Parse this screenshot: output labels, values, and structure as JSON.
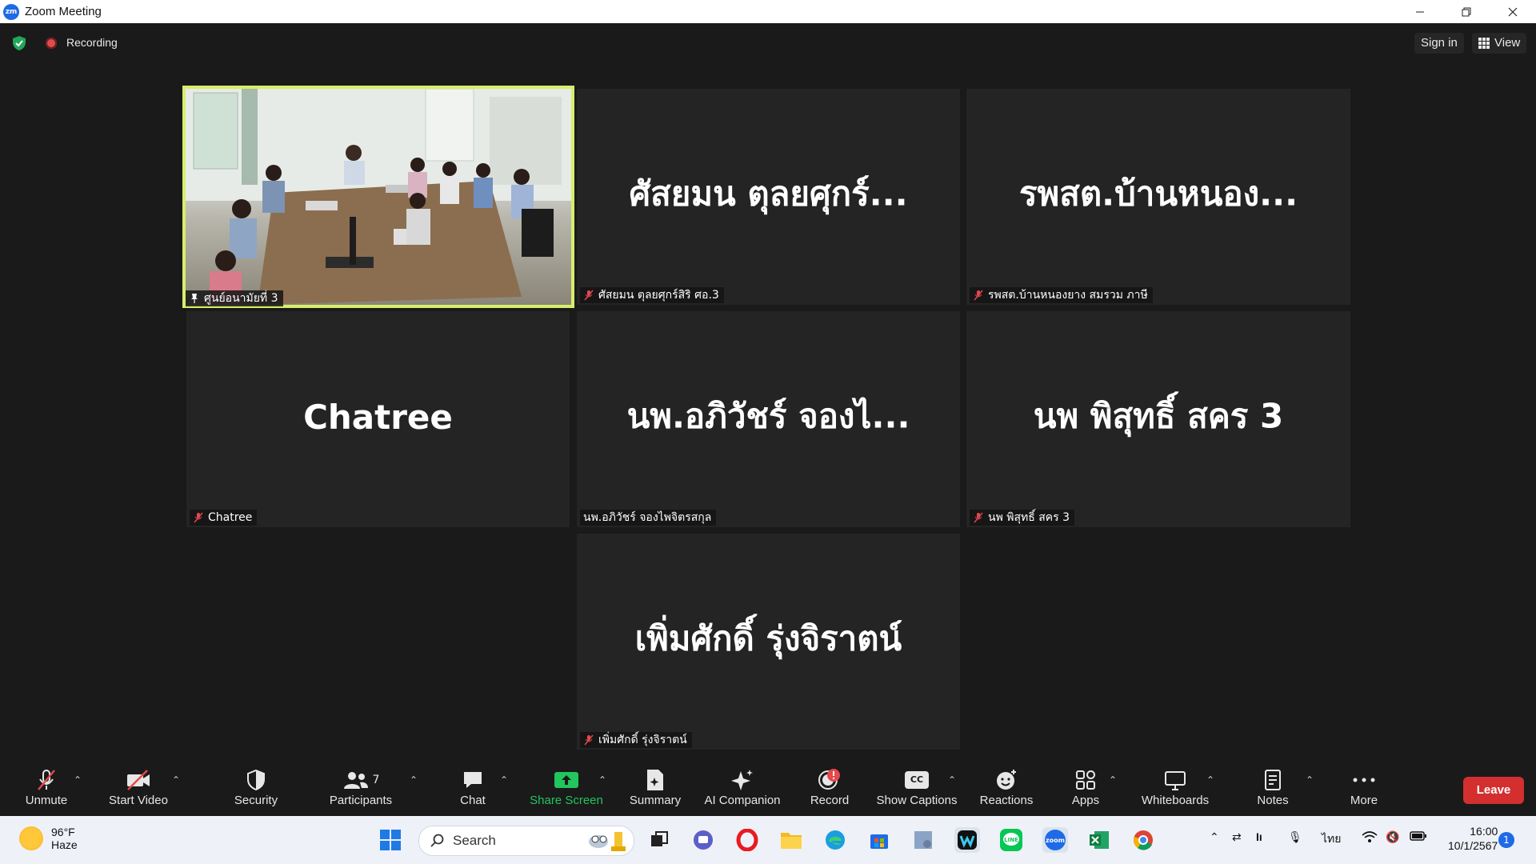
{
  "window": {
    "title": "Zoom Meeting",
    "app_icon_text": "zm"
  },
  "topbar": {
    "recording_label": "Recording",
    "sign_in_label": "Sign in",
    "view_label": "View"
  },
  "tiles": [
    {
      "big_name": "",
      "label": "ศูนย์อนามัยที่ 3",
      "pinned": true,
      "active": true,
      "has_video": true
    },
    {
      "big_name": "ศัสยมน ตุลยศุกร์...",
      "label": "ศัสยมน ตุลยศุกร์สิริ ศอ.3",
      "muted": true
    },
    {
      "big_name": "รพสต.บ้านหนอง...",
      "label": "รพสต.บ้านหนองยาง สมรวม ภาษี",
      "muted": true
    },
    {
      "big_name": "Chatree",
      "label": "Chatree",
      "muted": true
    },
    {
      "big_name": "นพ.อภิวัชร์ จองไ...",
      "label": "นพ.อภิวัชร์ จองไพจิตรสกุล",
      "muted": false
    },
    {
      "big_name": "นพ พิสุทธิ์ สคร 3",
      "label": "นพ พิสุทธิ์ สคร 3",
      "muted": true
    },
    {
      "big_name": "เพิ่มศักดิ์ รุ่งจิราตน์",
      "label": "เพิ่มศักดิ์ รุ่งจิราตน์",
      "muted": true
    }
  ],
  "toolbar": {
    "unmute": "Unmute",
    "start_video": "Start Video",
    "security": "Security",
    "participants": "Participants",
    "participants_count": "7",
    "chat": "Chat",
    "share_screen": "Share Screen",
    "summary": "Summary",
    "ai_companion": "AI Companion",
    "record": "Record",
    "show_captions": "Show Captions",
    "captions_badge": "CC",
    "reactions": "Reactions",
    "apps": "Apps",
    "whiteboards": "Whiteboards",
    "notes": "Notes",
    "more": "More",
    "leave": "Leave"
  },
  "taskbar": {
    "temperature": "96°F",
    "condition": "Haze",
    "search_placeholder": "Search",
    "language": "ไทย",
    "time": "16:00",
    "date": "10/1/2567",
    "notification_count": "1"
  },
  "colors": {
    "active_speaker_border": "#d8ee6b",
    "leave_button": "#d32f2f",
    "share_screen_green": "#22c55e",
    "muted_red": "#e5484d"
  }
}
